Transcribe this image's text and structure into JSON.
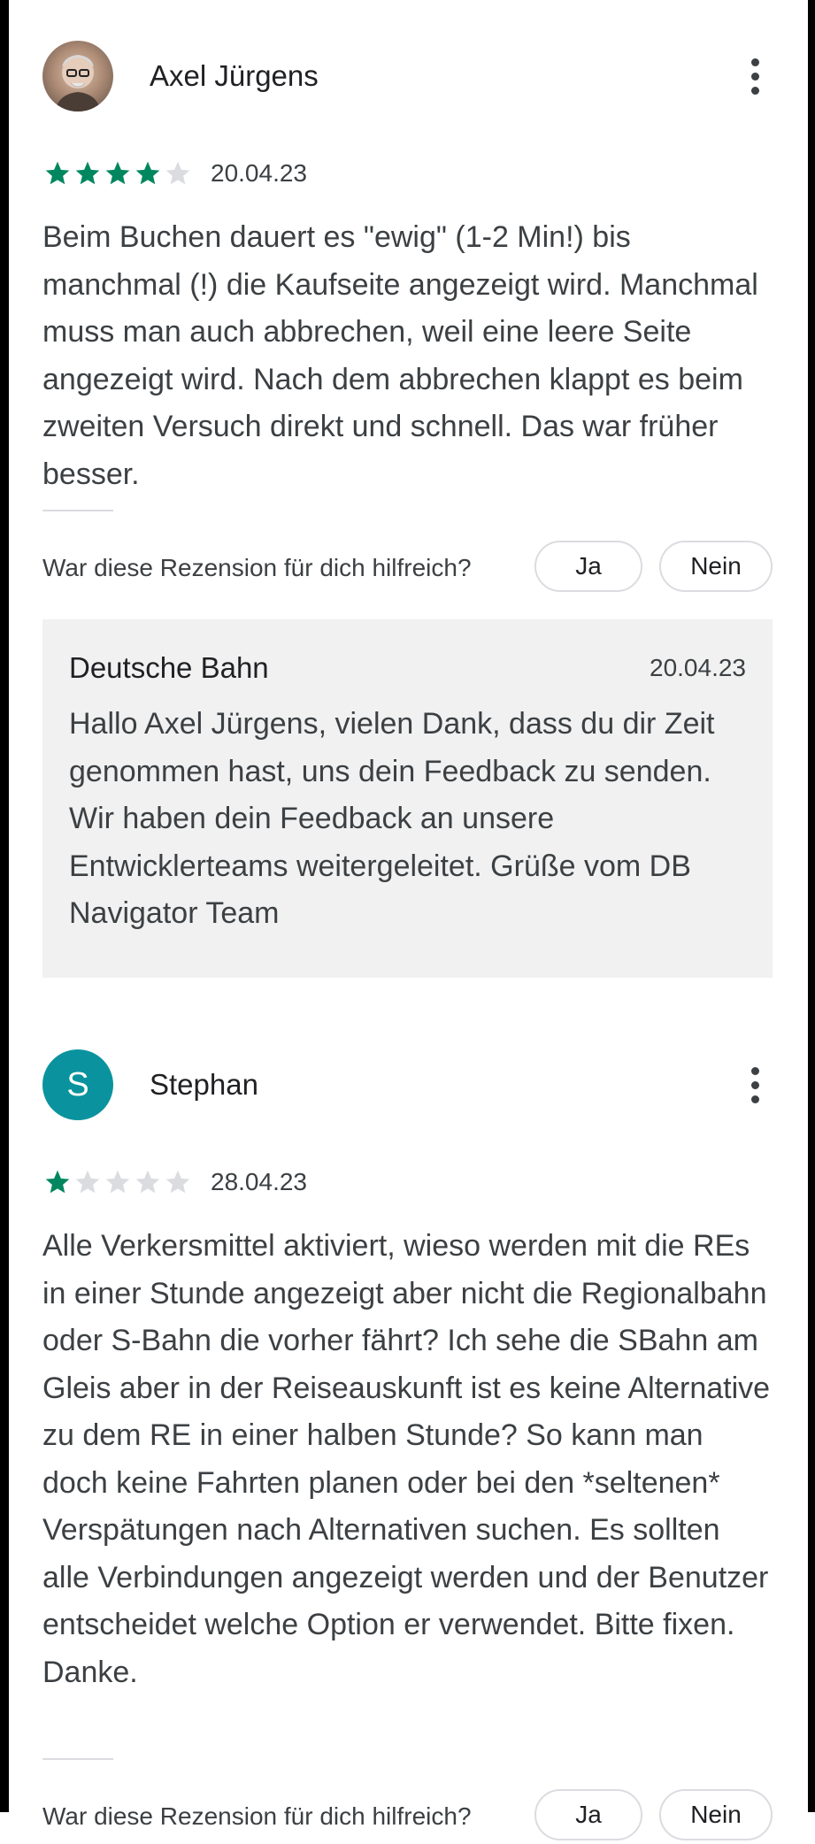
{
  "colors": {
    "star_filled": "#01875f",
    "star_empty": "#dadce0",
    "avatar_letter_bg": "#0a939e",
    "reply_bg": "#f1f1f1"
  },
  "reviews": [
    {
      "author": "Axel Jürgens",
      "avatar": "photo",
      "rating": 4,
      "max_rating": 5,
      "date": "20.04.23",
      "text": "Beim Buchen dauert es \"ewig\" (1-2 Min!) bis manchmal (!) die Kaufseite angezeigt wird. Manchmal muss man auch abbrechen, weil eine leere Seite angezeigt wird. Nach dem abbrechen klappt es beim zweiten Versuch direkt und schnell. Das war früher besser.",
      "helpful_question": "War diese Rezension für dich hilfreich?",
      "yes_label": "Ja",
      "no_label": "Nein",
      "reply": {
        "name": "Deutsche Bahn",
        "date": "20.04.23",
        "text": "Hallo Axel Jürgens, vielen Dank, dass du dir Zeit genommen hast, uns dein Feedback zu senden. Wir haben dein Feedback an unsere Entwicklerteams weitergeleitet. Grüße vom DB Navigator Team"
      }
    },
    {
      "author": "Stephan",
      "avatar_letter": "S",
      "rating": 1,
      "max_rating": 5,
      "date": "28.04.23",
      "text": "Alle Verkersmittel aktiviert, wieso werden mit die REs in einer Stunde angezeigt aber nicht die Regionalbahn oder S-Bahn die vorher fährt? Ich sehe die SBahn am Gleis aber in der Reiseauskunft ist es keine Alternative zu dem RE in einer halben Stunde? So kann man doch keine Fahrten planen oder bei den *seltenen* Verspätungen nach Alternativen suchen. Es sollten alle Verbindungen angezeigt werden und der Benutzer entscheidet welche Option er verwendet. Bitte fixen. Danke.",
      "helpful_question": "War diese Rezension für dich hilfreich?",
      "yes_label": "Ja",
      "no_label": "Nein"
    }
  ],
  "icons": {
    "more": "more-vert-icon",
    "star": "star-icon"
  }
}
